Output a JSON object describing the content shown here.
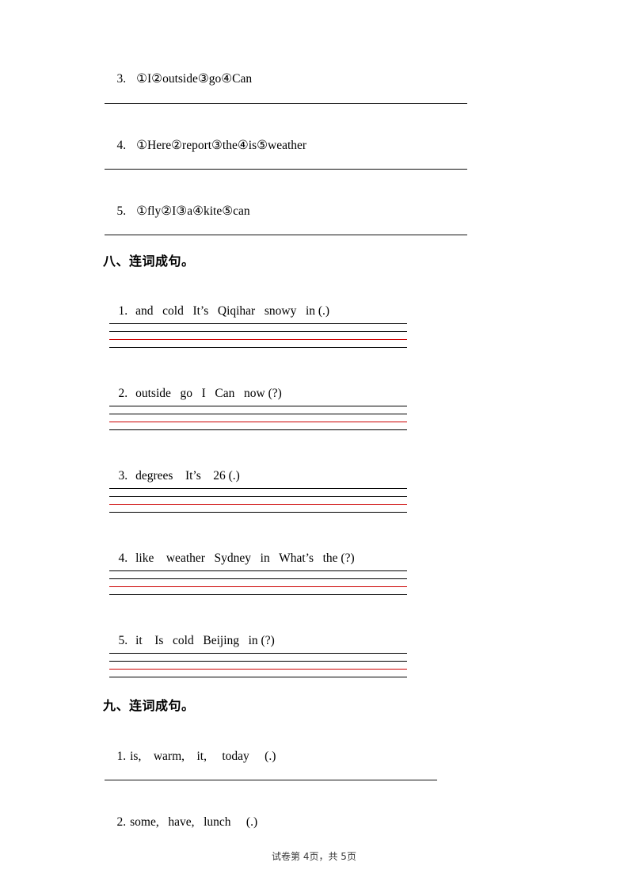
{
  "document": {
    "type": "exam-paper",
    "page_background": "#ffffff",
    "text_color": "#000000",
    "guide_red_line_color": "#cc0000"
  },
  "top_items": [
    {
      "number": "3.",
      "text": "①I②outside③go④Can"
    },
    {
      "number": "4.",
      "text": "①Here②report③the④is⑤weather"
    },
    {
      "number": "5.",
      "text": "①fly②I③a④kite⑤can"
    }
  ],
  "section_eight": {
    "heading": "八、连词成句。",
    "items": [
      {
        "number": "1.",
        "text": "and   cold   It’s   Qiqihar   snowy   in (.)"
      },
      {
        "number": "2.",
        "text": "outside   go   I   Can   now (?)"
      },
      {
        "number": "3.",
        "text": "degrees    It’s    26 (.)"
      },
      {
        "number": "4.",
        "text": "like    weather   Sydney   in   What’s   the (?)"
      },
      {
        "number": "5.",
        "text": "it    Is   cold   Beijing   in (?)"
      }
    ]
  },
  "section_nine": {
    "heading": "九、连词成句。",
    "items": [
      {
        "number": "1.",
        "text": "is,    warm,    it,     today     (.)"
      },
      {
        "number": "2.",
        "text": "some,   have,   lunch     (.)"
      }
    ]
  },
  "footer": {
    "text": "试卷第 4页，共 5页"
  }
}
